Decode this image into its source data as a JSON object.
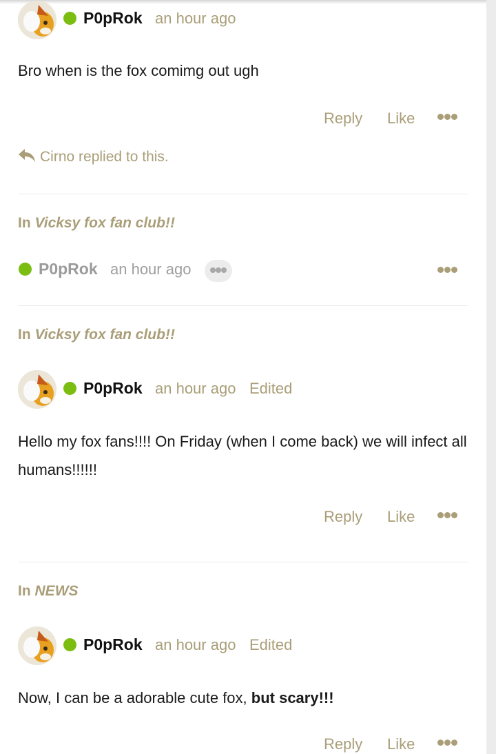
{
  "colors": {
    "accent": "#a99e78",
    "online": "#7cbd12",
    "text": "#1a1a1a"
  },
  "posts": [
    {
      "username": "P0pRok",
      "time": "an hour ago",
      "body": "Bro when is the fox comimg out ugh",
      "actions": {
        "reply": "Reply",
        "like": "Like",
        "more_icon": "more-horizontal-icon"
      },
      "replied_note": "Cirno replied to this.",
      "replied_icon": "reply-arrow-icon"
    },
    {
      "context_prefix": "In",
      "context_name": "Vicksy fox fan club!!",
      "username": "P0pRok",
      "time": "an hour ago",
      "more_icon": "more-horizontal-icon"
    },
    {
      "context_prefix": "In",
      "context_name": "Vicksy fox fan club!!",
      "username": "P0pRok",
      "time": "an hour ago",
      "edited": "Edited",
      "body": "Hello my fox fans!!!! On Friday (when I come back) we will infect all humans!!!!!!",
      "actions": {
        "reply": "Reply",
        "like": "Like",
        "more_icon": "more-horizontal-icon"
      }
    },
    {
      "context_prefix": "In",
      "context_name": "NEWS",
      "username": "P0pRok",
      "time": "an hour ago",
      "edited": "Edited",
      "body_plain": "Now, I can be a adorable cute fox, ",
      "body_bold": "but scary!!!",
      "actions": {
        "reply": "Reply",
        "like": "Like",
        "more_icon": "more-horizontal-icon"
      }
    }
  ]
}
